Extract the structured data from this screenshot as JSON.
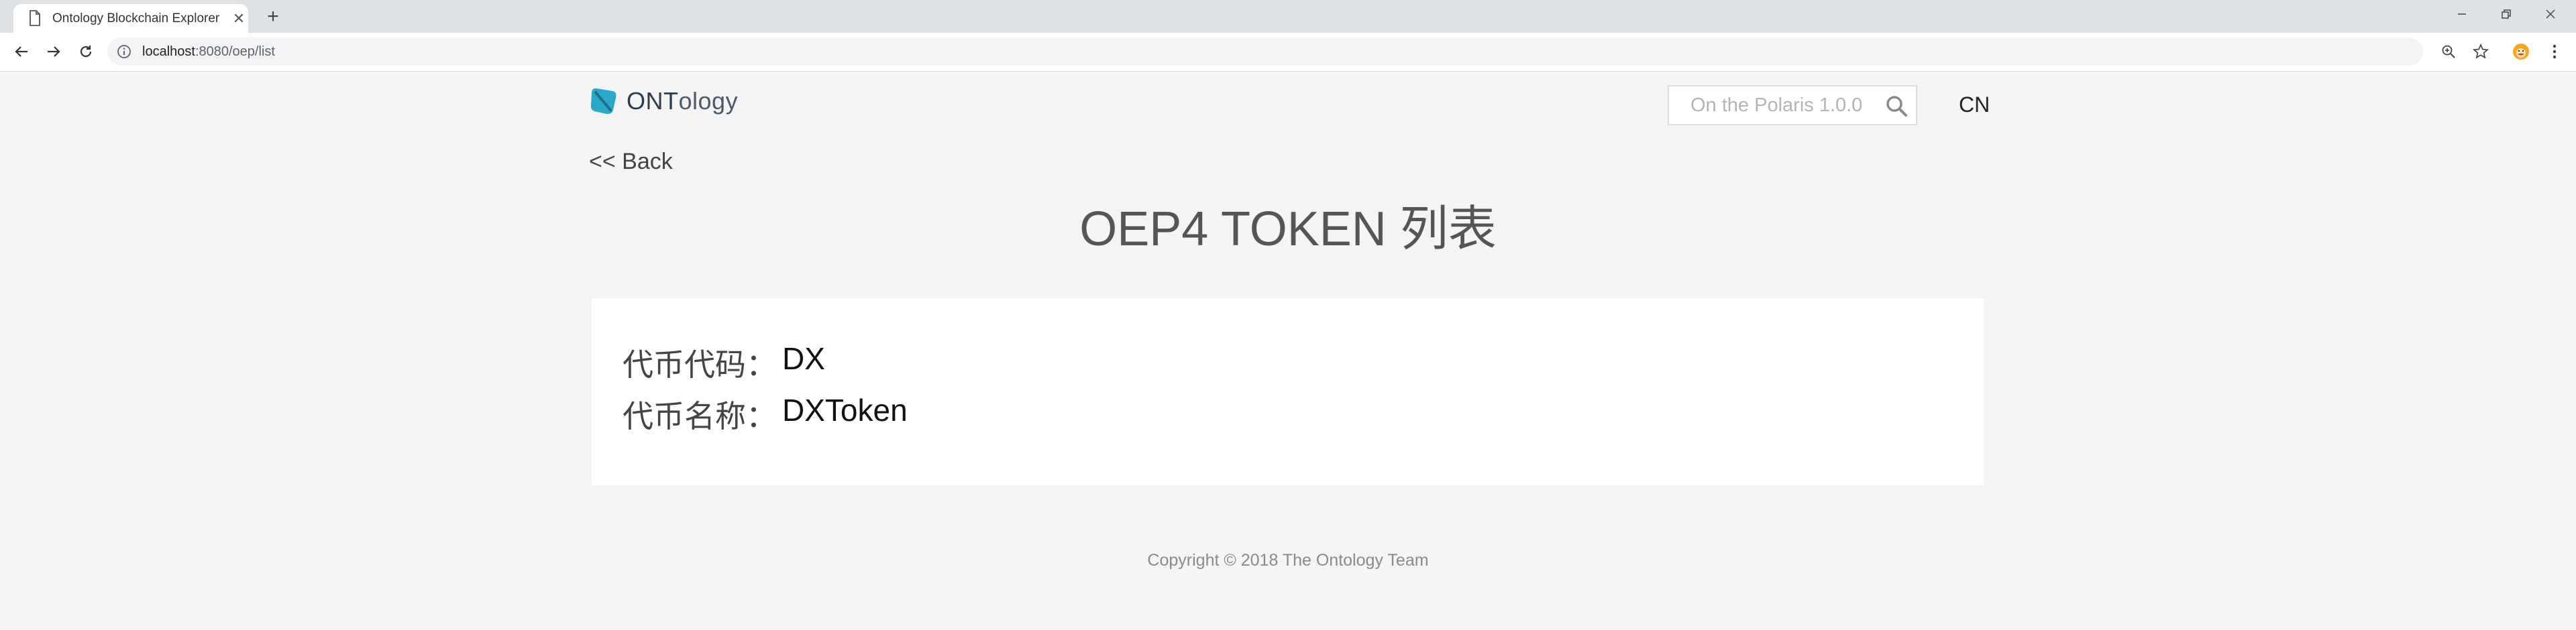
{
  "browser": {
    "tab_title": "Ontology Blockchain Explorer",
    "url_host": "localhost",
    "url_rest": ":8080/oep/list"
  },
  "header": {
    "logo_bold": "ONT",
    "logo_light": "ology",
    "search_placeholder": "On the Polaris 1.0.0",
    "language": "CN"
  },
  "nav": {
    "back_label": "<< Back"
  },
  "main": {
    "title": "OEP4 TOKEN 列表",
    "token": {
      "code_label": "代币代码：",
      "code_value": "DX",
      "name_label": "代币名称：",
      "name_value": "DXToken"
    }
  },
  "footer": {
    "copyright": "Copyright © 2018 The Ontology Team"
  },
  "colors": {
    "brand": "#2aa8c8",
    "background": "#f4f4f4"
  }
}
